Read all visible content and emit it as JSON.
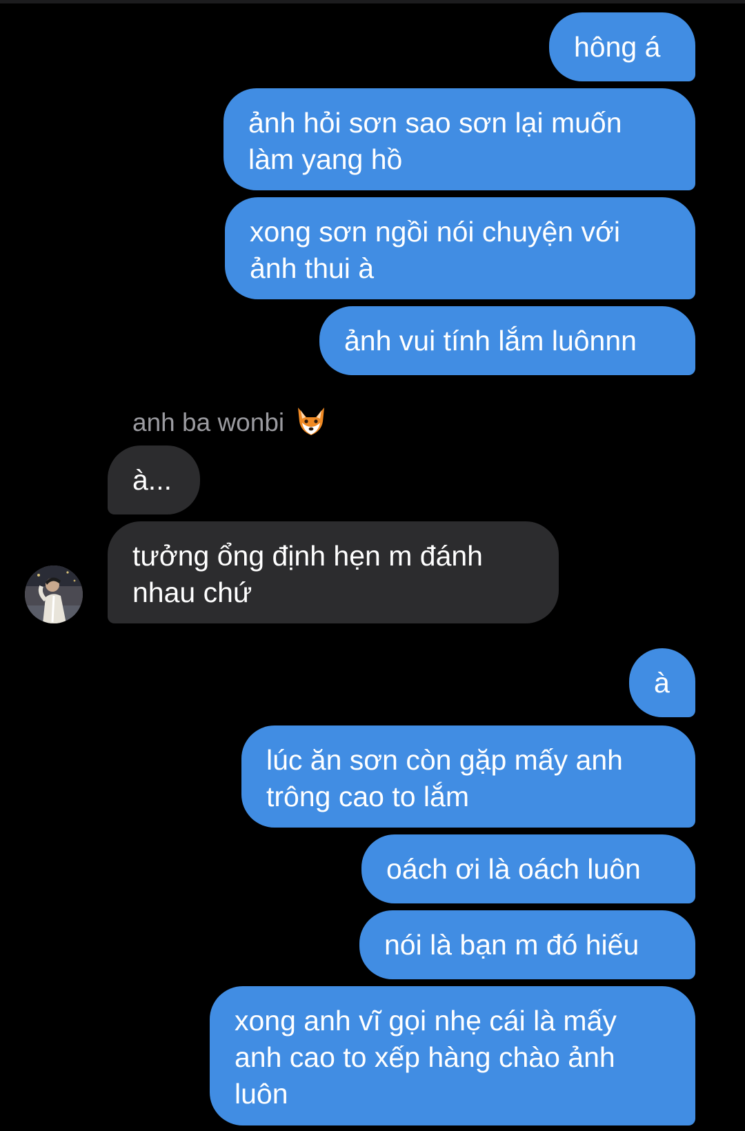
{
  "thread": {
    "sender_name": "anh ba wonbi",
    "sender_emoji_icon": "fox-face-icon",
    "colors": {
      "outgoing_bubble": "#418de3",
      "incoming_bubble": "#2c2c2e",
      "background": "#000000",
      "sender_name": "#9b9ba0"
    },
    "messages": [
      {
        "direction": "out",
        "text": "hông á"
      },
      {
        "direction": "out",
        "text": "ảnh hỏi sơn sao sơn lại muốn làm yang hồ"
      },
      {
        "direction": "out",
        "text": "xong sơn ngồi nói chuyện với ảnh thui à"
      },
      {
        "direction": "out",
        "text": "ảnh vui tính lắm luônnn"
      },
      {
        "direction": "in",
        "text": "à..."
      },
      {
        "direction": "in",
        "text": "tưởng ổng định hẹn m đánh nhau chứ"
      },
      {
        "direction": "out",
        "text": "à"
      },
      {
        "direction": "out",
        "text": "lúc ăn sơn còn gặp mấy anh trông cao to lắm"
      },
      {
        "direction": "out",
        "text": "oách ơi là oách luôn"
      },
      {
        "direction": "out",
        "text": "nói là bạn m đó hiếu"
      },
      {
        "direction": "out",
        "text": "xong anh vĩ gọi nhẹ cái là mấy anh cao to xếp hàng chào ảnh luôn"
      }
    ]
  }
}
